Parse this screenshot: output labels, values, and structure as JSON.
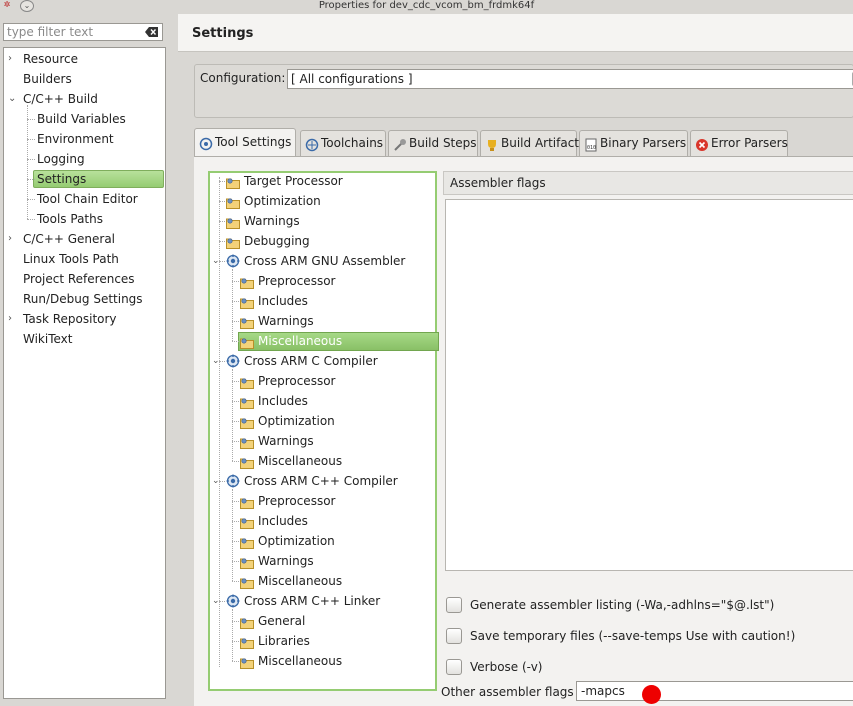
{
  "window": {
    "title": "Properties for dev_cdc_vcom_bm_frdmk64f"
  },
  "filter": {
    "placeholder": "type filter text"
  },
  "nav": {
    "items": [
      {
        "label": "Resource",
        "expand": "›",
        "level": 0
      },
      {
        "label": "Builders",
        "level": 0
      },
      {
        "label": "C/C++ Build",
        "expand": "⌄",
        "level": 0
      },
      {
        "label": "Build Variables",
        "level": 1
      },
      {
        "label": "Environment",
        "level": 1
      },
      {
        "label": "Logging",
        "level": 1
      },
      {
        "label": "Settings",
        "level": 1,
        "selected": true
      },
      {
        "label": "Tool Chain Editor",
        "level": 1
      },
      {
        "label": "Tools Paths",
        "level": 1
      },
      {
        "label": "C/C++ General",
        "expand": "›",
        "level": 0
      },
      {
        "label": "Linux Tools Path",
        "level": 0
      },
      {
        "label": "Project References",
        "level": 0
      },
      {
        "label": "Run/Debug Settings",
        "level": 0
      },
      {
        "label": "Task Repository",
        "expand": "›",
        "level": 0
      },
      {
        "label": "WikiText",
        "level": 0
      }
    ]
  },
  "header": {
    "title": "Settings"
  },
  "configuration": {
    "label": "Configuration:",
    "value": "[ All configurations ]"
  },
  "tabs": [
    {
      "label": "Tool Settings",
      "active": true
    },
    {
      "label": "Toolchains"
    },
    {
      "label": "Build Steps"
    },
    {
      "label": "Build Artifact"
    },
    {
      "label": "Binary Parsers"
    },
    {
      "label": "Error Parsers"
    }
  ],
  "tool_tree": [
    {
      "label": "Target Processor",
      "icon": "folder-settings-icon",
      "level": 1
    },
    {
      "label": "Optimization",
      "icon": "folder-settings-icon",
      "level": 1
    },
    {
      "label": "Warnings",
      "icon": "folder-settings-icon",
      "level": 1
    },
    {
      "label": "Debugging",
      "icon": "folder-settings-icon",
      "level": 1
    },
    {
      "label": "Cross ARM GNU Assembler",
      "icon": "tool-gear-icon",
      "level": 1,
      "expanded": true
    },
    {
      "label": "Preprocessor",
      "icon": "folder-settings-icon",
      "level": 2
    },
    {
      "label": "Includes",
      "icon": "folder-settings-icon",
      "level": 2
    },
    {
      "label": "Warnings",
      "icon": "folder-settings-icon",
      "level": 2
    },
    {
      "label": "Miscellaneous",
      "icon": "folder-settings-icon",
      "level": 2,
      "selected": true
    },
    {
      "label": "Cross ARM C Compiler",
      "icon": "tool-gear-icon",
      "level": 1,
      "expanded": true
    },
    {
      "label": "Preprocessor",
      "icon": "folder-settings-icon",
      "level": 2
    },
    {
      "label": "Includes",
      "icon": "folder-settings-icon",
      "level": 2
    },
    {
      "label": "Optimization",
      "icon": "folder-settings-icon",
      "level": 2
    },
    {
      "label": "Warnings",
      "icon": "folder-settings-icon",
      "level": 2
    },
    {
      "label": "Miscellaneous",
      "icon": "folder-settings-icon",
      "level": 2
    },
    {
      "label": "Cross ARM C++ Compiler",
      "icon": "tool-gear-icon",
      "level": 1,
      "expanded": true
    },
    {
      "label": "Preprocessor",
      "icon": "folder-settings-icon",
      "level": 2
    },
    {
      "label": "Includes",
      "icon": "folder-settings-icon",
      "level": 2
    },
    {
      "label": "Optimization",
      "icon": "folder-settings-icon",
      "level": 2
    },
    {
      "label": "Warnings",
      "icon": "folder-settings-icon",
      "level": 2
    },
    {
      "label": "Miscellaneous",
      "icon": "folder-settings-icon",
      "level": 2
    },
    {
      "label": "Cross ARM C++ Linker",
      "icon": "tool-gear-icon",
      "level": 1,
      "expanded": true
    },
    {
      "label": "General",
      "icon": "folder-settings-icon",
      "level": 2
    },
    {
      "label": "Libraries",
      "icon": "folder-settings-icon",
      "level": 2
    },
    {
      "label": "Miscellaneous",
      "icon": "folder-settings-icon",
      "level": 2
    }
  ],
  "assembler": {
    "flags_title": "Assembler flags",
    "flags_value": "",
    "checkboxes": [
      {
        "label": "Generate assembler listing (-Wa,-adhlns=\"$@.lst\")",
        "checked": false
      },
      {
        "label": "Save temporary files (--save-temps Use with caution!)",
        "checked": false
      },
      {
        "label": "Verbose (-v)",
        "checked": false
      }
    ],
    "other_label": "Other assembler flags",
    "other_value": "-mapcs"
  },
  "colors": {
    "selection": "#95cc72",
    "marker": "#ee0000"
  }
}
